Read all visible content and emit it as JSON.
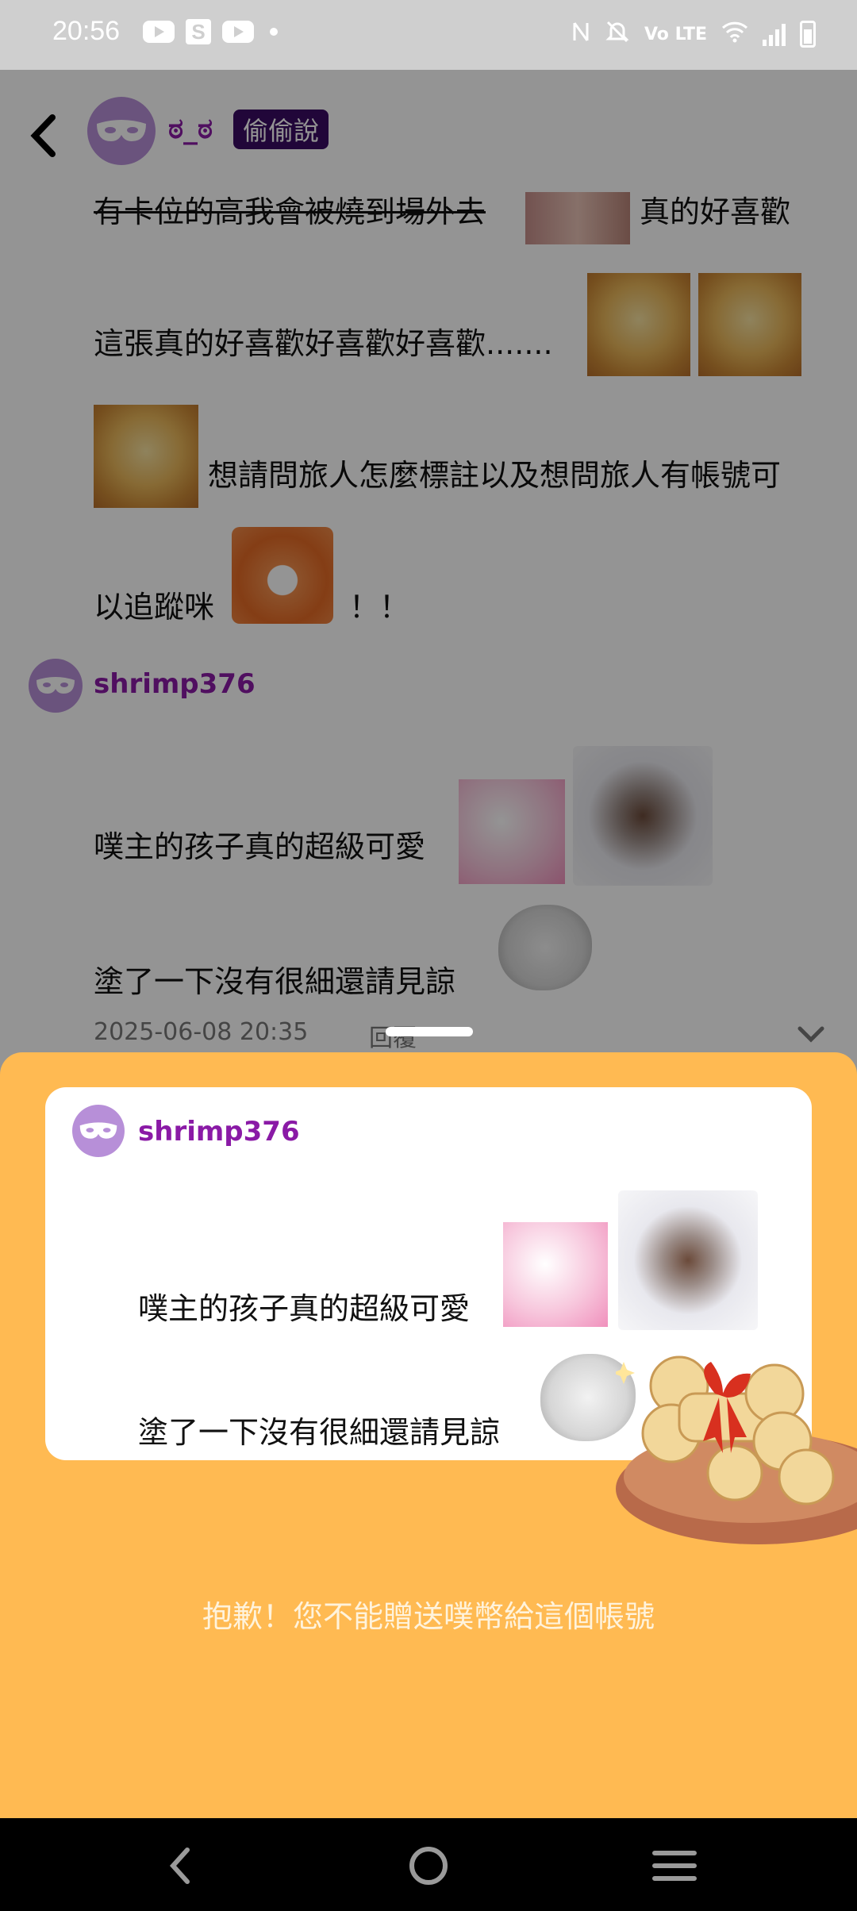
{
  "status_bar": {
    "time": "20:56",
    "left_icons": [
      "youtube-icon",
      "s-app-icon",
      "youtube-icon",
      "dot-icon"
    ],
    "right_icons": [
      "nfc-icon",
      "mute-icon",
      "volte-icon",
      "wifi-icon",
      "signal-icon",
      "battery-icon"
    ],
    "volte_label": "Vo LTE"
  },
  "post": {
    "author_name": "ಠ_ಠ",
    "badge": "偷偷說",
    "line1_struck": "有卡位的高我會被燒到場外去",
    "line1_rest": "真的好喜歡",
    "line2": "這張真的好喜歡好喜歡好喜歡.......",
    "line3": "想請問旅人怎麼標註以及想問旅人有帳號可",
    "line4a": "以追蹤咪",
    "line4b": "！！"
  },
  "comment": {
    "author": "shrimp376",
    "line1": "噗主的孩子真的超級可愛",
    "line2": "塗了一下沒有很細還請見諒",
    "timestamp": "2025-06-08 20:35",
    "reply_label": "回覆"
  },
  "sheet": {
    "author": "shrimp376",
    "line1": "噗主的孩子真的超級可愛",
    "line2": "塗了一下沒有很細還請見諒",
    "notice": "抱歉！您不能贈送噗幣給這個帳號"
  },
  "colors": {
    "sheet_bg": "#ffba52",
    "username": "#8a1aa6",
    "badge_bg": "#3a0c62",
    "avatar": "#b78fd8"
  },
  "nav": [
    "back-icon",
    "home-icon",
    "menu-icon"
  ]
}
